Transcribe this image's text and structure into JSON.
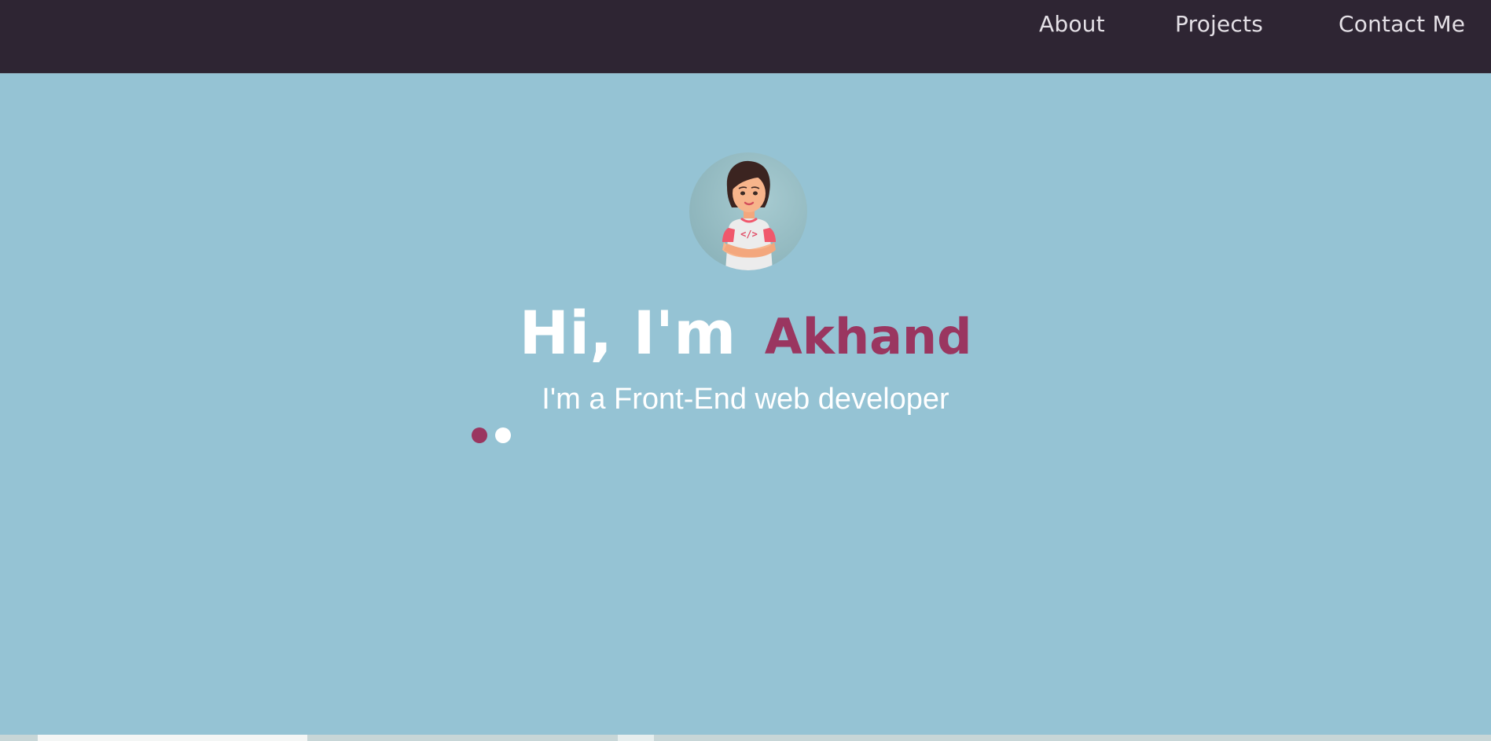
{
  "nav": {
    "items": [
      {
        "label": "About"
      },
      {
        "label": "Projects"
      },
      {
        "label": "Contact Me"
      }
    ]
  },
  "hero": {
    "avatar_icon": "developer-avatar-icon",
    "greeting": "Hi, I'm",
    "name": "Akhand",
    "subtitle": "I'm a Front-End web developer",
    "carousel_active_dot": 1,
    "carousel_dot_count": 2
  },
  "colors": {
    "navbar_bg": "#2e2533",
    "hero_bg": "#95c3d4",
    "accent": "#9a3660",
    "text_light": "#ffffff"
  }
}
